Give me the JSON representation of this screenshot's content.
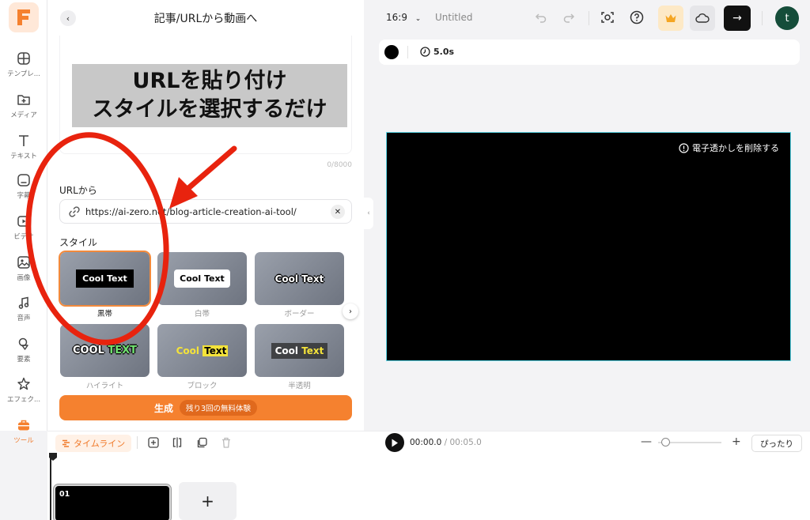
{
  "rail": {
    "items": [
      {
        "label": "テンプレ...",
        "icon": "template-icon"
      },
      {
        "label": "メディア",
        "icon": "media-folder-icon"
      },
      {
        "label": "テキスト",
        "icon": "text-icon"
      },
      {
        "label": "字幕",
        "icon": "subtitle-icon"
      },
      {
        "label": "ビデオ",
        "icon": "video-icon"
      },
      {
        "label": "画像",
        "icon": "image-icon"
      },
      {
        "label": "音声",
        "icon": "music-icon"
      },
      {
        "label": "要素",
        "icon": "elements-icon"
      },
      {
        "label": "エフェク...",
        "icon": "effects-icon"
      },
      {
        "label": "ツール",
        "icon": "toolbox-icon",
        "active": true
      }
    ],
    "accent": "#f5812f"
  },
  "panel": {
    "title": "記事/URLから動画へ",
    "banner_line1": "URLを貼り付け",
    "banner_line2": "スタイルを選択するだけ",
    "counter": "0/8000",
    "url_label": "URLから",
    "url_value": "https://ai-zero.net/blog-article-creation-ai-tool/",
    "style_label": "スタイル",
    "styles": [
      {
        "name": "黒帯",
        "sample": "Cool Text",
        "selected": true
      },
      {
        "name": "白帯",
        "sample": "Cool Text"
      },
      {
        "name": "ボーダー",
        "sample": "Cool Text"
      },
      {
        "name": "ハイライト",
        "sample_a": "COOL",
        "sample_b": "TEXT"
      },
      {
        "name": "ブロック",
        "sample_a": "Cool",
        "sample_b": "Text"
      },
      {
        "name": "半透明",
        "sample_a": "Cool",
        "sample_b": "Text"
      }
    ],
    "generate_label": "生成",
    "trial_label": "残り3回の無料体験"
  },
  "topbar": {
    "ratio": "16:9",
    "doc_title": "Untitled"
  },
  "props": {
    "duration": "5.0s",
    "color": "#000000"
  },
  "canvas": {
    "watermark": "電子透かしを削除する"
  },
  "timeline": {
    "button": "タイムライン",
    "current": "00:00.0",
    "total": "/ 00:05.0",
    "fit": "ぴったり",
    "clip_number": "01",
    "add": "+"
  }
}
